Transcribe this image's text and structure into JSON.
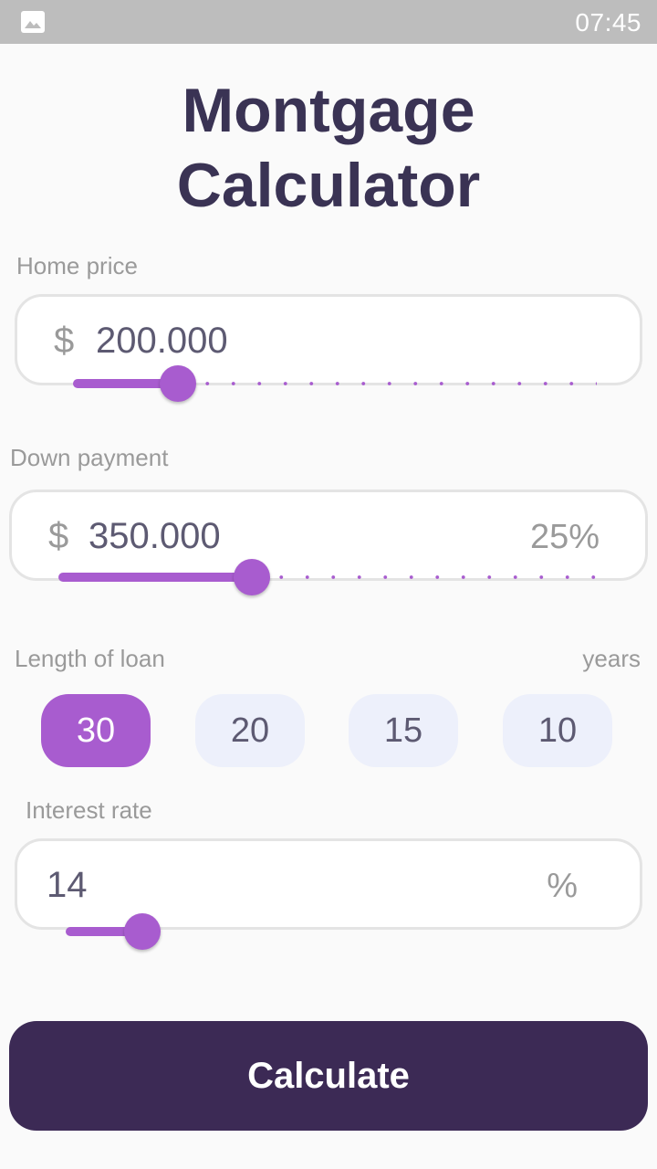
{
  "status_bar": {
    "time": "07:45",
    "image_icon": "image-icon"
  },
  "title": {
    "line1": "Montgage",
    "line2": "Calculator"
  },
  "home_price": {
    "label": "Home price",
    "currency": "$",
    "value": "200.000",
    "slider_fraction": 0.2
  },
  "down_payment": {
    "label": "Down payment",
    "currency": "$",
    "value": "350.000",
    "percent": "25%",
    "slider_fraction": 0.35
  },
  "loan_length": {
    "label": "Length of loan",
    "unit": "years",
    "options": [
      "30",
      "20",
      "15",
      "10"
    ],
    "selected": "30"
  },
  "interest_rate": {
    "label": "Interest rate",
    "value": "14",
    "unit": "%",
    "slider_fraction": 0.14
  },
  "calculate_button": {
    "label": "Calculate"
  },
  "colors": {
    "accent": "#a85ccf",
    "title": "#3a3354",
    "button": "#3c2a55",
    "chip_bg": "#edf0fb",
    "status_bar": "#bdbdbd"
  }
}
